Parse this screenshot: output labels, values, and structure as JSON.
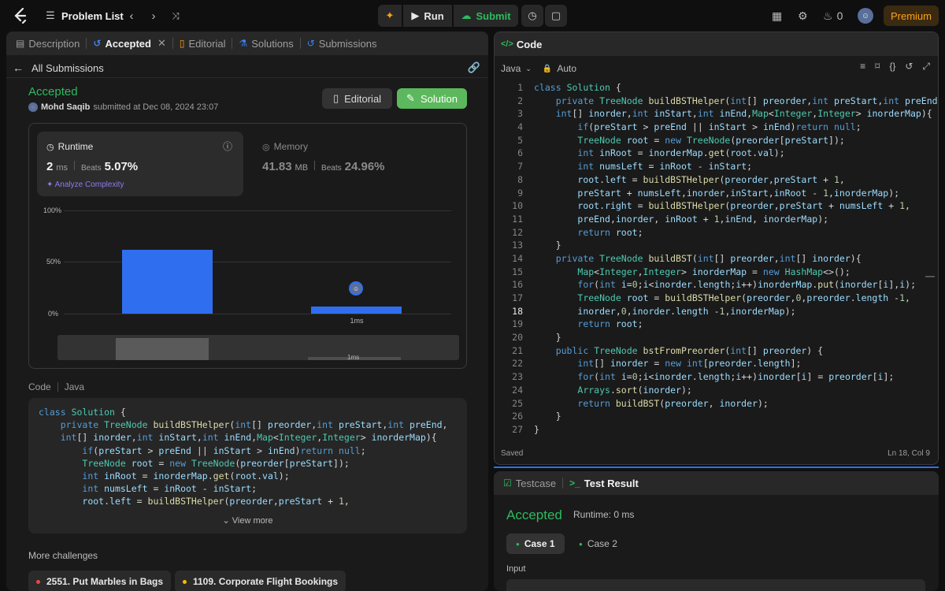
{
  "topbar": {
    "title": "Problem List",
    "run_label": "Run",
    "submit_label": "Submit",
    "streak_count": "0",
    "premium_label": "Premium"
  },
  "left_tabs": {
    "description": "Description",
    "accepted": "Accepted",
    "editorial": "Editorial",
    "solutions": "Solutions",
    "submissions": "Submissions"
  },
  "submission": {
    "back_label": "All Submissions",
    "status": "Accepted",
    "user": "Mohd Saqib",
    "submitted_text": "submitted at Dec 08, 2024 23:07",
    "editorial_button": "Editorial",
    "solution_button": "Solution"
  },
  "stats": {
    "runtime_label": "Runtime",
    "runtime_value": "2",
    "runtime_unit": "ms",
    "beats_label": "Beats",
    "runtime_beats": "5.07%",
    "analyze_label": "Analyze Complexity",
    "memory_label": "Memory",
    "memory_value": "41.83",
    "memory_unit": "MB",
    "memory_beats": "24.96%"
  },
  "chart_data": {
    "type": "bar",
    "categories": [
      "",
      "1ms"
    ],
    "values": [
      0.62,
      0.07
    ],
    "ylim": [
      0,
      1
    ],
    "ytick_labels": [
      "100%",
      "50%",
      "0%"
    ],
    "overview_label": "1ms"
  },
  "code_section": {
    "label": "Code",
    "language": "Java",
    "view_more": "View more"
  },
  "preview_code": [
    "class Solution {",
    "    private TreeNode buildBSTHelper(int[] preorder,int preStart,int preEnd,",
    "    int[] inorder,int inStart,int inEnd,Map<Integer,Integer> inorderMap){",
    "        if(preStart > preEnd || inStart > inEnd)return null;",
    "        TreeNode root = new TreeNode(preorder[preStart]);",
    "        int inRoot = inorderMap.get(root.val);",
    "        int numsLeft = inRoot - inStart;",
    "        root.left = buildBSTHelper(preorder,preStart + 1,"
  ],
  "more_challenges": {
    "label": "More challenges",
    "items": [
      {
        "title": "2551. Put Marbles in Bags",
        "color": "#ef4743"
      },
      {
        "title": "1109. Corporate Flight Bookings",
        "color": "#ffb800"
      }
    ]
  },
  "editor": {
    "title": "Code",
    "language": "Java",
    "mode": "Auto",
    "status": "Saved",
    "cursor": "Ln 18, Col 9",
    "current_line": 18,
    "lines": [
      "class Solution {",
      "    private TreeNode buildBSTHelper(int[] preorder,int preStart,int preEnd,",
      "    int[] inorder,int inStart,int inEnd,Map<Integer,Integer> inorderMap){",
      "        if(preStart > preEnd || inStart > inEnd)return null;",
      "        TreeNode root = new TreeNode(preorder[preStart]);",
      "        int inRoot = inorderMap.get(root.val);",
      "        int numsLeft = inRoot - inStart;",
      "        root.left = buildBSTHelper(preorder,preStart + 1,",
      "        preStart + numsLeft,inorder,inStart,inRoot - 1,inorderMap);",
      "        root.right = buildBSTHelper(preorder,preStart + numsLeft + 1,",
      "        preEnd,inorder, inRoot + 1,inEnd, inorderMap);",
      "        return root;",
      "    }",
      "    private TreeNode buildBST(int[] preorder,int[] inorder){",
      "        Map<Integer,Integer> inorderMap = new HashMap<>();",
      "        for(int i=0;i<inorder.length;i++)inorderMap.put(inorder[i],i);",
      "        TreeNode root = buildBSTHelper(preorder,0,preorder.length -1,",
      "        inorder,0,inorder.length -1,inorderMap);",
      "        return root;",
      "    }",
      "    public TreeNode bstFromPreorder(int[] preorder) {",
      "        int[] inorder = new int[preorder.length];",
      "        for(int i=0;i<inorder.length;i++)inorder[i] = preorder[i];",
      "        Arrays.sort(inorder);",
      "        return buildBST(preorder, inorder);",
      "    }",
      "}"
    ]
  },
  "bottom": {
    "testcase_tab": "Testcase",
    "result_tab": "Test Result",
    "status": "Accepted",
    "runtime": "Runtime: 0 ms",
    "case1": "Case 1",
    "case2": "Case 2",
    "input_label": "Input"
  }
}
